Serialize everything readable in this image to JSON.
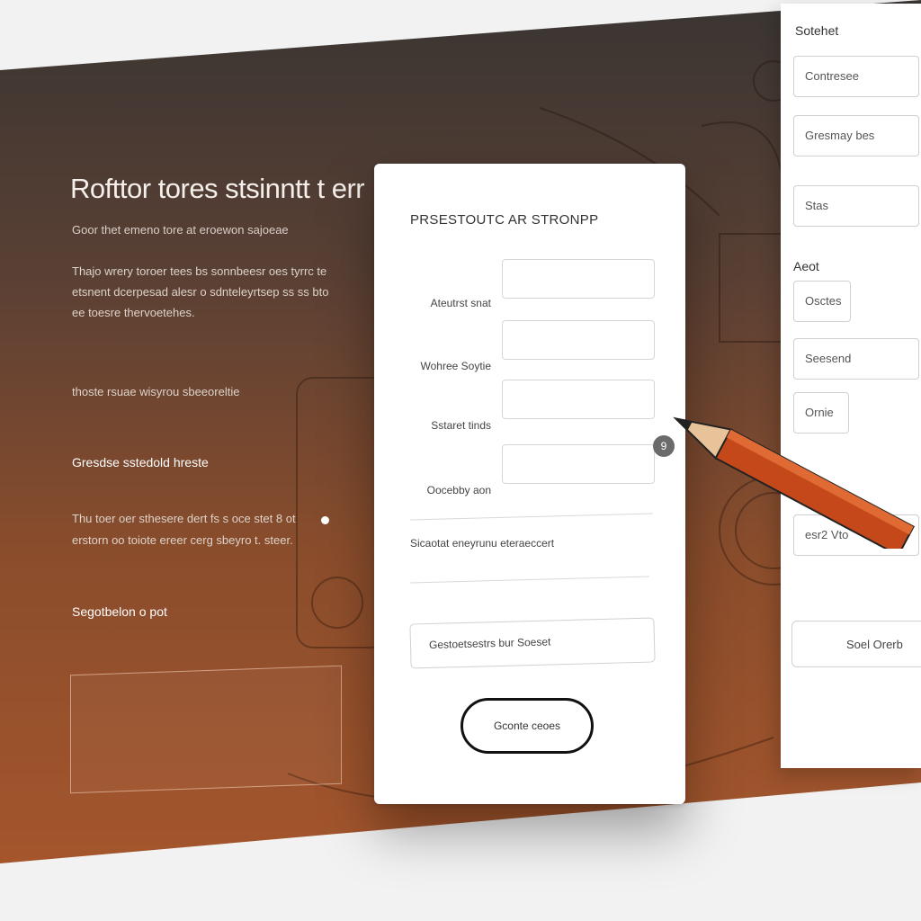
{
  "hero": {
    "title": "Rofttor tores stsinntt t err",
    "subtitle": "Goor thet emeno tore at eroewon sajoeae",
    "paragraph": "Thajo wrery toroer tees bs sonnbeesr oes tyrrc te etsnent dcerpesad alesr o sdnteleyrtsep ss ss bto ee toesre thervoetehes.",
    "line4": "thoste rsuae wisyrou sbeeoreltie",
    "bold1": "Gresdse sstedold hreste",
    "paragraph2": "Thu toer oer sthesere dert fs s oce stet 8 ot erstorn oo toiote ereer cerg sbeyro t. steer.",
    "bold2": "Segotbelon o pot"
  },
  "form": {
    "title": "PRSESTOUTC AR STRONPP",
    "fields": [
      {
        "label": "Ateutrst snat"
      },
      {
        "label": "Wohree Soytie"
      },
      {
        "label": "Sstaret tinds"
      },
      {
        "label": "Oocebby aon"
      }
    ],
    "note": "Sicaotat eneyrunu eteraeccert",
    "wide_input_text": "Gestoetsestrs bur Soeset",
    "submit_label": "Gconte ceoes",
    "help_icon_glyph": "9"
  },
  "side": {
    "heading1": "Sotehet",
    "inputs1": [
      "Contresee",
      "Gresmay bes",
      "Stas"
    ],
    "heading2": "Aeot",
    "inputs2": [
      "Osctes",
      "Seesend",
      "Ornie"
    ],
    "input3": "esr2 Vto",
    "button": "Soel Orerb"
  },
  "colors": {
    "hero_top": "#3a3532",
    "hero_bottom": "#a9572c",
    "pencil_body": "#c4481a",
    "card": "#ffffff"
  }
}
